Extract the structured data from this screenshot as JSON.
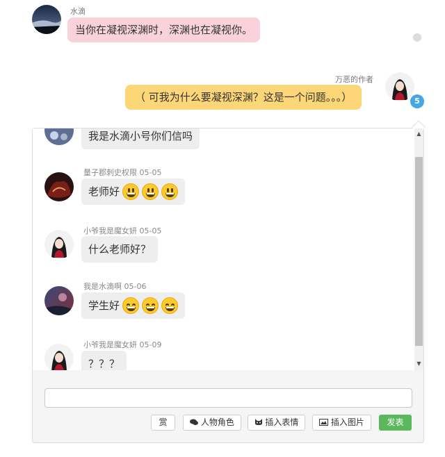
{
  "top_chat": {
    "left_message": {
      "name": "水滴",
      "text": "当你在凝视深渊时，深渊也在凝视你。"
    },
    "right_message": {
      "name": "万恶的作者",
      "text": "（ 可我为什么要凝视深渊？这是一个问题。。。）",
      "badge": "5"
    }
  },
  "chat_panel": {
    "messages": [
      {
        "name": "",
        "date": "",
        "text": "我是水滴小号你们信吗",
        "emojis": []
      },
      {
        "name": "量子郡刺史权限",
        "date": "05-05",
        "text": "老师好",
        "emojis": [
          "grinning-emoji",
          "grinning-emoji",
          "grinning-emoji"
        ]
      },
      {
        "name": "小爷我是魔女妍",
        "date": "05-05",
        "text": "什么老师好？",
        "emojis": []
      },
      {
        "name": "我是水滴啊",
        "date": "05-06",
        "text": "学生好",
        "emojis": [
          "beaming-emoji",
          "beaming-emoji",
          "beaming-emoji"
        ]
      },
      {
        "name": "小爷我是魔女妍",
        "date": "05-09",
        "text": "？？？",
        "emojis": []
      }
    ],
    "input": {
      "value": "",
      "placeholder": ""
    },
    "toolbar": {
      "reward_label": "赏",
      "role_label": "人物角色",
      "emoji_label": "插入表情",
      "image_label": "插入图片",
      "submit_label": "发表"
    }
  },
  "colors": {
    "pink_bubble": "#f9d2dc",
    "yellow_bubble": "#fcd677",
    "badge": "#47a7e4",
    "submit_button": "#5cb85c",
    "message_bubble": "#eeeeee"
  }
}
